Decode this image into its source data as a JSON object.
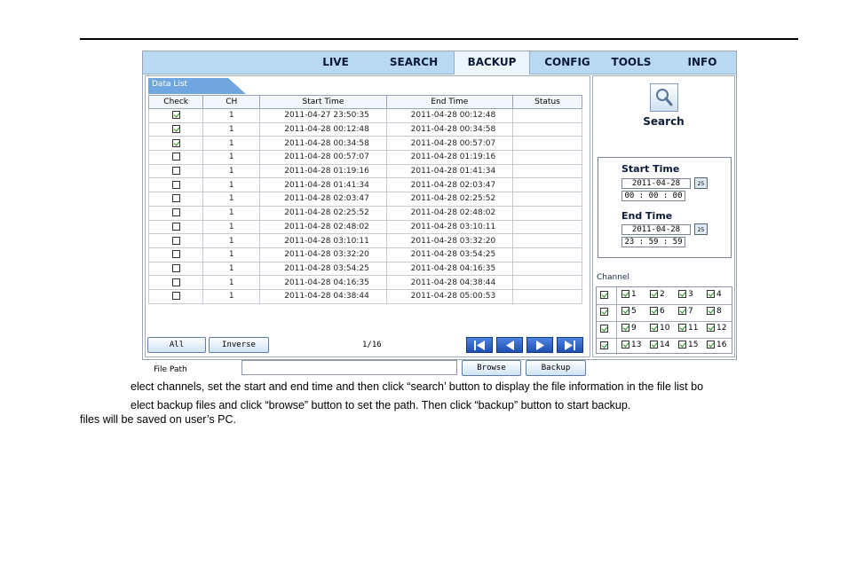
{
  "tabs": [
    {
      "label": "LIVE",
      "active": false
    },
    {
      "label": "SEARCH",
      "active": false
    },
    {
      "label": "BACKUP",
      "active": true
    },
    {
      "label": "CONFIG",
      "active": false
    },
    {
      "label": "TOOLS",
      "active": false
    },
    {
      "label": "INFO",
      "active": false
    }
  ],
  "data_list": {
    "tab_label": "Data List",
    "columns": [
      "Check",
      "CH",
      "Start Time",
      "End Time",
      "Status"
    ],
    "rows": [
      {
        "checked": true,
        "ch": "1",
        "start": "2011-04-27 23:50:35",
        "end": "2011-04-28 00:12:48",
        "status": ""
      },
      {
        "checked": true,
        "ch": "1",
        "start": "2011-04-28 00:12:48",
        "end": "2011-04-28 00:34:58",
        "status": ""
      },
      {
        "checked": true,
        "ch": "1",
        "start": "2011-04-28 00:34:58",
        "end": "2011-04-28 00:57:07",
        "status": ""
      },
      {
        "checked": false,
        "ch": "1",
        "start": "2011-04-28 00:57:07",
        "end": "2011-04-28 01:19:16",
        "status": ""
      },
      {
        "checked": false,
        "ch": "1",
        "start": "2011-04-28 01:19:16",
        "end": "2011-04-28 01:41:34",
        "status": ""
      },
      {
        "checked": false,
        "ch": "1",
        "start": "2011-04-28 01:41:34",
        "end": "2011-04-28 02:03:47",
        "status": ""
      },
      {
        "checked": false,
        "ch": "1",
        "start": "2011-04-28 02:03:47",
        "end": "2011-04-28 02:25:52",
        "status": ""
      },
      {
        "checked": false,
        "ch": "1",
        "start": "2011-04-28 02:25:52",
        "end": "2011-04-28 02:48:02",
        "status": ""
      },
      {
        "checked": false,
        "ch": "1",
        "start": "2011-04-28 02:48:02",
        "end": "2011-04-28 03:10:11",
        "status": ""
      },
      {
        "checked": false,
        "ch": "1",
        "start": "2011-04-28 03:10:11",
        "end": "2011-04-28 03:32:20",
        "status": ""
      },
      {
        "checked": false,
        "ch": "1",
        "start": "2011-04-28 03:32:20",
        "end": "2011-04-28 03:54:25",
        "status": ""
      },
      {
        "checked": false,
        "ch": "1",
        "start": "2011-04-28 03:54:25",
        "end": "2011-04-28 04:16:35",
        "status": ""
      },
      {
        "checked": false,
        "ch": "1",
        "start": "2011-04-28 04:16:35",
        "end": "2011-04-28 04:38:44",
        "status": ""
      },
      {
        "checked": false,
        "ch": "1",
        "start": "2011-04-28 04:38:44",
        "end": "2011-04-28 05:00:53",
        "status": ""
      }
    ]
  },
  "controls": {
    "all_label": "All",
    "inverse_label": "Inverse",
    "pager": "1/16",
    "nav_icons": [
      "first-page-icon",
      "prev-page-icon",
      "next-page-icon",
      "last-page-icon"
    ],
    "file_path_label": "File Path",
    "file_path_value": "",
    "browse_label": "Browse",
    "backup_label": "Backup"
  },
  "search_panel": {
    "search_label": "Search",
    "search_icon": "magnifier-icon",
    "start_time_label": "Start Time",
    "start_date": "2011-04-28",
    "start_time": "00 : 00 : 00",
    "end_time_label": "End Time",
    "end_date": "2011-04-28",
    "end_time": "23 : 59 : 59",
    "calendar_text": "25",
    "channel_label": "Channel",
    "channels": [
      [
        "1",
        "2",
        "3",
        "4"
      ],
      [
        "5",
        "6",
        "7",
        "8"
      ],
      [
        "9",
        "10",
        "11",
        "12"
      ],
      [
        "13",
        "14",
        "15",
        "16"
      ]
    ]
  },
  "instructions": [
    "elect channels, set the start and end time and then click “search’ button to display the file information in the file list bo",
    "elect backup files and click “browse” button to set the path. Then click “backup” button to start backup.",
    "files will be saved on user’s PC."
  ],
  "colors": {
    "tab_bar": "#b9d9f3",
    "data_list_tab": "#6fa6e0",
    "nav_button": "#1e4fb0",
    "check": "#1a8a1a"
  }
}
